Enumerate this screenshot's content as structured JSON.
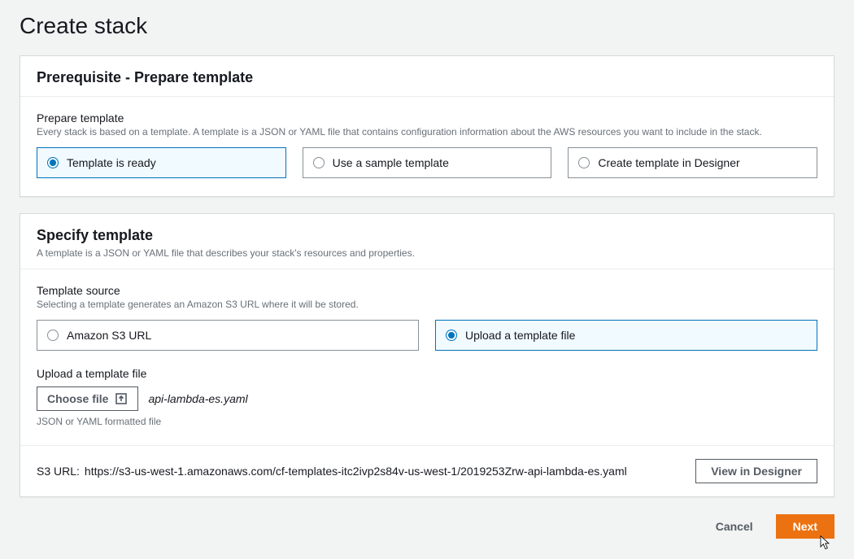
{
  "page": {
    "title": "Create stack"
  },
  "panel1": {
    "title": "Prerequisite - Prepare template",
    "field_label": "Prepare template",
    "field_hint": "Every stack is based on a template. A template is a JSON or YAML file that contains configuration information about the AWS resources you want to include in the stack.",
    "options": {
      "ready": "Template is ready",
      "sample": "Use a sample template",
      "designer": "Create template in Designer"
    }
  },
  "panel2": {
    "title": "Specify template",
    "subtitle": "A template is a JSON or YAML file that describes your stack's resources and properties.",
    "source_label": "Template source",
    "source_hint": "Selecting a template generates an Amazon S3 URL where it will be stored.",
    "options": {
      "s3": "Amazon S3 URL",
      "upload": "Upload a template file"
    },
    "upload_label": "Upload a template file",
    "choose_label": "Choose file",
    "filename": "api-lambda-es.yaml",
    "file_hint": "JSON or YAML formatted file",
    "s3_label": "S3 URL:",
    "s3_url": "https://s3-us-west-1.amazonaws.com/cf-templates-itc2ivp2s84v-us-west-1/2019253Zrw-api-lambda-es.yaml",
    "view_designer": "View in Designer"
  },
  "actions": {
    "cancel": "Cancel",
    "next": "Next"
  }
}
